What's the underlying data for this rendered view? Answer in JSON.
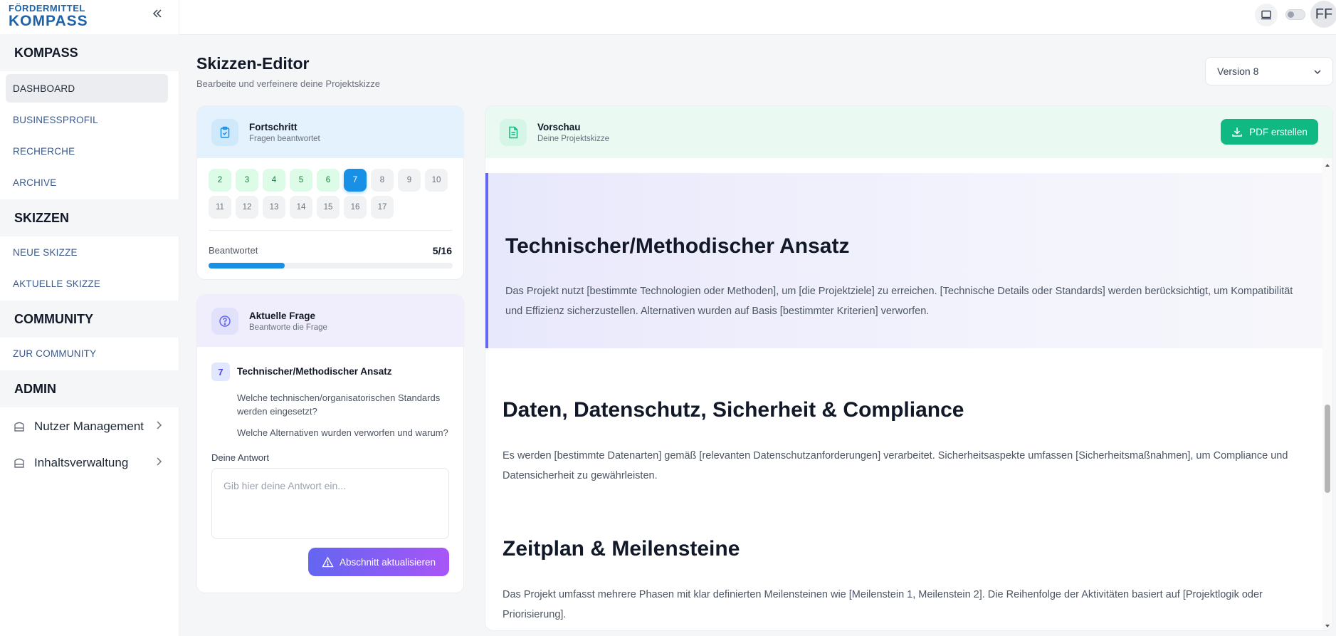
{
  "brand": {
    "line1": "FÖRDERMITTEL",
    "line2": "KOMPASS"
  },
  "sidebar": {
    "sections": [
      {
        "title": "KOMPASS",
        "items": [
          "DASHBOARD",
          "BUSINESSPROFIL",
          "RECHERCHE",
          "ARCHIVE"
        ]
      },
      {
        "title": "SKIZZEN",
        "items": [
          "NEUE SKIZZE",
          "AKTUELLE SKIZZE"
        ]
      },
      {
        "title": "COMMUNITY",
        "items": [
          "ZUR COMMUNITY"
        ]
      },
      {
        "title": "ADMIN",
        "items": [
          "Nutzer Management",
          "Inhaltsverwaltung"
        ]
      }
    ],
    "active_item": "DASHBOARD"
  },
  "topbar": {
    "avatar_initials": "FF",
    "theme_toggle_on": false
  },
  "page": {
    "title": "Skizzen-Editor",
    "subtitle": "Bearbeite und verfeinere deine Projektskizze",
    "version_selected": "Version 8"
  },
  "progress_card": {
    "title": "Fortschritt",
    "subtitle": "Fragen beantwortet",
    "questions": [
      {
        "n": "2",
        "state": "done"
      },
      {
        "n": "3",
        "state": "done"
      },
      {
        "n": "4",
        "state": "done"
      },
      {
        "n": "5",
        "state": "done"
      },
      {
        "n": "6",
        "state": "done"
      },
      {
        "n": "7",
        "state": "current"
      },
      {
        "n": "8",
        "state": "open"
      },
      {
        "n": "9",
        "state": "open"
      },
      {
        "n": "10",
        "state": "open"
      },
      {
        "n": "11",
        "state": "open"
      },
      {
        "n": "12",
        "state": "open"
      },
      {
        "n": "13",
        "state": "open"
      },
      {
        "n": "14",
        "state": "open"
      },
      {
        "n": "15",
        "state": "open"
      },
      {
        "n": "16",
        "state": "open"
      },
      {
        "n": "17",
        "state": "open"
      }
    ],
    "answered_label": "Beantwortet",
    "answered_count": "5/16",
    "progress_fraction": 0.3125
  },
  "question_card": {
    "title": "Aktuelle Frage",
    "subtitle": "Beantworte die Frage",
    "number": "7",
    "question_title": "Technischer/Methodischer Ansatz",
    "prompts": [
      "Welche technischen/organisatorischen Standards werden eingesetzt?",
      "Welche Alternativen wurden verworfen und warum?"
    ],
    "answer_label": "Deine Antwort",
    "answer_placeholder": "Gib hier deine Antwort ein...",
    "update_button": "Abschnitt aktualisieren"
  },
  "preview_card": {
    "title": "Vorschau",
    "subtitle": "Deine Projektskizze",
    "pdf_button": "PDF erstellen",
    "sections": [
      {
        "heading": "Technischer/Methodischer Ansatz",
        "text": "Das Projekt nutzt [bestimmte Technologien oder Methoden], um [die Projektziele] zu erreichen. [Technische Details oder Standards] werden berücksichtigt, um Kompatibilität und Effizienz sicherzustellen. Alternativen wurden auf Basis [bestimmter Kriterien] verworfen.",
        "highlighted": true
      },
      {
        "heading": "Daten, Datenschutz, Sicherheit & Compliance",
        "text": "Es werden [bestimmte Datenarten] gemäß [relevanten Datenschutzanforderungen] verarbeitet. Sicherheitsaspekte umfassen [Sicherheitsmaßnahmen], um Compliance und Datensicherheit zu gewährleisten.",
        "highlighted": false
      },
      {
        "heading": "Zeitplan & Meilensteine",
        "text": "Das Projekt umfasst mehrere Phasen mit klar definierten Meilensteinen wie [Meilenstein 1, Meilenstein 2]. Die Reihenfolge der Aktivitäten basiert auf [Projektlogik oder Priorisierung].",
        "highlighted": false
      }
    ]
  },
  "colors": {
    "brand": "#1e63a8",
    "accent_blue": "#1890e6",
    "success": "#10b981",
    "purple_start": "#6366f1",
    "purple_end": "#a855f7"
  }
}
